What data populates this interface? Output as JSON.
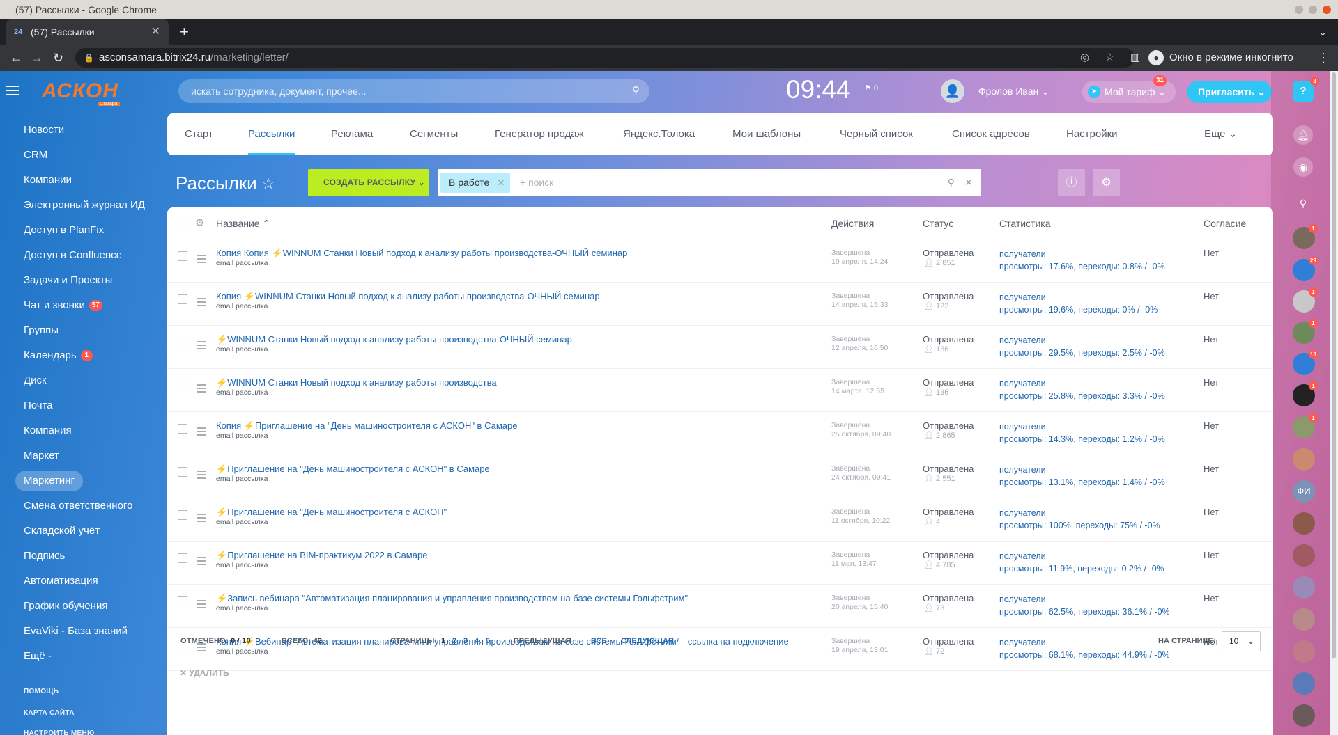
{
  "browser": {
    "window_title": "(57) Рассылки - Google Chrome",
    "tab_title": "(57) Рассылки",
    "tab_favicon": "24",
    "url_host": "asconsamara.bitrix24.ru",
    "url_path": "/marketing/letter/",
    "incognito_label": "Окно в режиме инкогнито"
  },
  "header": {
    "logo_text": "АСКОН",
    "logo_sub": "Самара",
    "search_placeholder": "искать сотрудника, документ, прочее...",
    "clock": "09:44",
    "flag_count": "0",
    "user_name": "Фролов Иван",
    "tarif_label": "Мой тариф",
    "tarif_badge": "31",
    "invite_label": "Пригласить",
    "help_badge": "3"
  },
  "sidebar": {
    "items": [
      {
        "label": "Новости",
        "badge": ""
      },
      {
        "label": "CRM",
        "badge": ""
      },
      {
        "label": "Компании",
        "badge": ""
      },
      {
        "label": "Электронный журнал ИД",
        "badge": ""
      },
      {
        "label": "Доступ в PlanFix",
        "badge": ""
      },
      {
        "label": "Доступ в Confluence",
        "badge": ""
      },
      {
        "label": "Задачи и Проекты",
        "badge": ""
      },
      {
        "label": "Чат и звонки",
        "badge": "57"
      },
      {
        "label": "Группы",
        "badge": ""
      },
      {
        "label": "Календарь",
        "badge": "1"
      },
      {
        "label": "Диск",
        "badge": ""
      },
      {
        "label": "Почта",
        "badge": ""
      },
      {
        "label": "Компания",
        "badge": ""
      },
      {
        "label": "Маркет",
        "badge": ""
      },
      {
        "label": "Маркетинг",
        "badge": ""
      },
      {
        "label": "Смена ответственного",
        "badge": ""
      },
      {
        "label": "Складской учёт",
        "badge": ""
      },
      {
        "label": "Подпись",
        "badge": ""
      },
      {
        "label": "Автоматизация",
        "badge": ""
      },
      {
        "label": "График обучения",
        "badge": ""
      },
      {
        "label": "EvaViki - База знаний",
        "badge": ""
      },
      {
        "label": "Ещё -",
        "badge": ""
      }
    ],
    "active_index": 14,
    "footer": [
      "ПОМОЩЬ",
      "КАРТА САЙТА",
      "НАСТРОИТЬ МЕНЮ"
    ]
  },
  "topnav": {
    "items": [
      "Старт",
      "Рассылки",
      "Реклама",
      "Сегменты",
      "Генератор продаж",
      "Яндекс.Толока",
      "Мои шаблоны",
      "Черный список",
      "Список адресов",
      "Настройки",
      "Еще"
    ],
    "active_index": 1
  },
  "page": {
    "title": "Рассылки",
    "create_button": "СОЗДАТЬ РАССЫЛКУ",
    "filter_tag": "В работе",
    "filter_search_placeholder": "+ поиск"
  },
  "grid": {
    "columns": [
      "Название",
      "Действия",
      "Статус",
      "Статистика",
      "Согласие"
    ],
    "rows": [
      {
        "prefix": "Копия Копия ",
        "name": "WINNUM Станки Новый подход к анализу работы производства-ОЧНЫЙ семинар",
        "type": "email рассылка",
        "done": "Завершена",
        "date": "19 апреля, 14:24",
        "status": "Отправлена",
        "count": "2 851",
        "recipients": "получатели",
        "stats": "просмотры: 17.6%, переходы: 0.8% / -0%",
        "consent": "Нет"
      },
      {
        "prefix": "Копия ",
        "name": "WINNUM Станки Новый подход к анализу работы производства-ОЧНЫЙ семинар",
        "type": "email рассылка",
        "done": "Завершена",
        "date": "14 апреля, 15:33",
        "status": "Отправлена",
        "count": "122",
        "recipients": "получатели",
        "stats": "просмотры: 19.6%, переходы: 0% / -0%",
        "consent": "Нет"
      },
      {
        "prefix": "",
        "name": "WINNUM Станки Новый подход к анализу работы производства-ОЧНЫЙ семинар",
        "type": "email рассылка",
        "done": "Завершена",
        "date": "12 апреля, 16:50",
        "status": "Отправлена",
        "count": "136",
        "recipients": "получатели",
        "stats": "просмотры: 29.5%, переходы: 2.5% / -0%",
        "consent": "Нет"
      },
      {
        "prefix": "",
        "name": "WINNUM Станки Новый подход к анализу работы производства",
        "type": "email рассылка",
        "done": "Завершена",
        "date": "14 марта, 12:55",
        "status": "Отправлена",
        "count": "136",
        "recipients": "получатели",
        "stats": "просмотры: 25.8%, переходы: 3.3% / -0%",
        "consent": "Нет"
      },
      {
        "prefix": "Копия ",
        "name": "Приглашение на \"День машиностроителя с АСКОН\" в Самаре",
        "type": "email рассылка",
        "done": "Завершена",
        "date": "25 октября, 09:40",
        "status": "Отправлена",
        "count": "2 865",
        "recipients": "получатели",
        "stats": "просмотры: 14.3%, переходы: 1.2% / -0%",
        "consent": "Нет"
      },
      {
        "prefix": "",
        "name": "Приглашение на \"День машиностроителя с АСКОН\" в Самаре",
        "type": "email рассылка",
        "done": "Завершена",
        "date": "24 октября, 09:41",
        "status": "Отправлена",
        "count": "2 551",
        "recipients": "получатели",
        "stats": "просмотры: 13.1%, переходы: 1.4% / -0%",
        "consent": "Нет"
      },
      {
        "prefix": "",
        "name": "Приглашение на \"День машиностроителя с АСКОН\"",
        "type": "email рассылка",
        "done": "Завершена",
        "date": "11 октября, 10:22",
        "status": "Отправлена",
        "count": "4",
        "recipients": "получатели",
        "stats": "просмотры: 100%, переходы: 75% / -0%",
        "consent": "Нет"
      },
      {
        "prefix": "",
        "name": "Приглашение на BIM-практикум 2022 в Самаре",
        "type": "email рассылка",
        "done": "Завершена",
        "date": "11 мая, 13:47",
        "status": "Отправлена",
        "count": "4 785",
        "recipients": "получатели",
        "stats": "просмотры: 11.9%, переходы: 0.2% / -0%",
        "consent": "Нет"
      },
      {
        "prefix": "",
        "name": "Запись вебинара \"Автоматизация планирования и управления производством на базе системы Гольфстрим\"",
        "type": "email рассылка",
        "done": "Завершена",
        "date": "20 апреля, 15:40",
        "status": "Отправлена",
        "count": "73",
        "recipients": "получатели",
        "stats": "просмотры: 62.5%, переходы: 36.1% / -0%",
        "consent": "Нет"
      },
      {
        "prefix": "Копия ",
        "name": "Вебинар \"Автоматизация планирования и управления производством на базе системы Гольфстрим\" - ссылка на подключение",
        "type": "email рассылка",
        "done": "Завершена",
        "date": "19 апреля, 13:01",
        "status": "Отправлена",
        "count": "72",
        "recipients": "получатели",
        "stats": "просмотры: 68.1%, переходы: 44.9% / -0%",
        "consent": "Нет"
      }
    ]
  },
  "footer": {
    "marked_label": "ОТМЕЧЕНО:",
    "marked_value": "0 / 10",
    "total_label": "ВСЕГО:",
    "total_value": "42",
    "pages_label": "СТРАНИЦЫ:",
    "pages": [
      "1",
      "2",
      "3",
      "4",
      "5"
    ],
    "prev": "ПРЕДЫДУЩАЯ",
    "all": "ВСЕ",
    "next": "СЛЕДУЮЩАЯ",
    "per_page_label": "НА СТРАНИЦЕ:",
    "per_page_value": "10",
    "delete": "УДАЛИТЬ"
  },
  "right_panel": {
    "avatars": [
      {
        "badge": "1",
        "text": ""
      },
      {
        "badge": "29",
        "text": ""
      },
      {
        "badge": "1",
        "text": ""
      },
      {
        "badge": "1",
        "text": ""
      },
      {
        "badge": "13",
        "text": ""
      },
      {
        "badge": "1",
        "text": ""
      },
      {
        "badge": "1",
        "text": ""
      },
      {
        "badge": "",
        "text": ""
      },
      {
        "badge": "",
        "text": "ФИ"
      },
      {
        "badge": "",
        "text": ""
      },
      {
        "badge": "",
        "text": ""
      },
      {
        "badge": "",
        "text": ""
      },
      {
        "badge": "",
        "text": ""
      },
      {
        "badge": "",
        "text": ""
      },
      {
        "badge": "",
        "text": ""
      },
      {
        "badge": "",
        "text": ""
      }
    ]
  },
  "colors": {
    "accent": "#2fc6f6",
    "create_button": "#bbed21",
    "link": "#2067b0",
    "badge": "#ff5752"
  }
}
